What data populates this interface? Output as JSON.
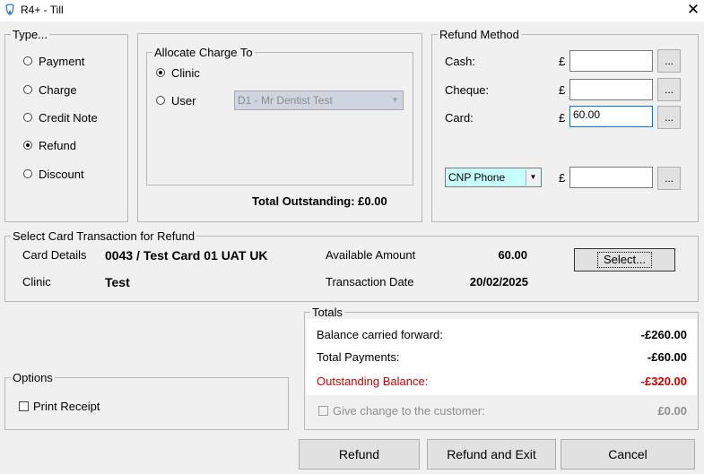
{
  "window": {
    "title": "R4+ - Till",
    "close_glyph": "✕"
  },
  "type_group": {
    "legend": "Type...",
    "options": [
      "Payment",
      "Charge",
      "Credit Note",
      "Refund",
      "Discount"
    ],
    "selected": "Refund"
  },
  "allocate": {
    "legend": "Allocate Charge To",
    "clinic_label": "Clinic",
    "user_label": "User",
    "selected": "Clinic",
    "user_value": "D1 - Mr Dentist Test",
    "total_outstanding": "Total Outstanding: £0.00"
  },
  "refund_method": {
    "legend": "Refund Method",
    "currency": "£",
    "rows": [
      {
        "label": "Cash:",
        "value": ""
      },
      {
        "label": "Cheque:",
        "value": ""
      },
      {
        "label": "Card:",
        "value": "60.00"
      }
    ],
    "dropdown_value": "CNP Phone",
    "dropdown_amount": "",
    "dots_label": "..."
  },
  "card_transaction": {
    "legend": "Select Card Transaction for Refund",
    "card_details_label": "Card Details",
    "card_details_value": "0043 / Test Card 01 UAT UK",
    "clinic_label": "Clinic",
    "clinic_value": "Test",
    "available_label": "Available Amount",
    "available_value": "60.00",
    "date_label": "Transaction Date",
    "date_value": "20/02/2025",
    "select_button": "Select..."
  },
  "options": {
    "legend": "Options",
    "print_receipt": "Print Receipt",
    "print_receipt_checked": false
  },
  "totals": {
    "legend": "Totals",
    "balance_cf_label": "Balance carried forward:",
    "balance_cf_value": "-£260.00",
    "total_payments_label": "Total Payments:",
    "total_payments_value": "-£60.00",
    "outstanding_label": "Outstanding Balance:",
    "outstanding_value": "-£320.00",
    "give_change_label": "Give change to the customer:",
    "give_change_value": "£0.00",
    "outstanding_color": "#cc0000"
  },
  "buttons": {
    "refund": "Refund",
    "refund_exit": "Refund and Exit",
    "cancel": "Cancel"
  }
}
